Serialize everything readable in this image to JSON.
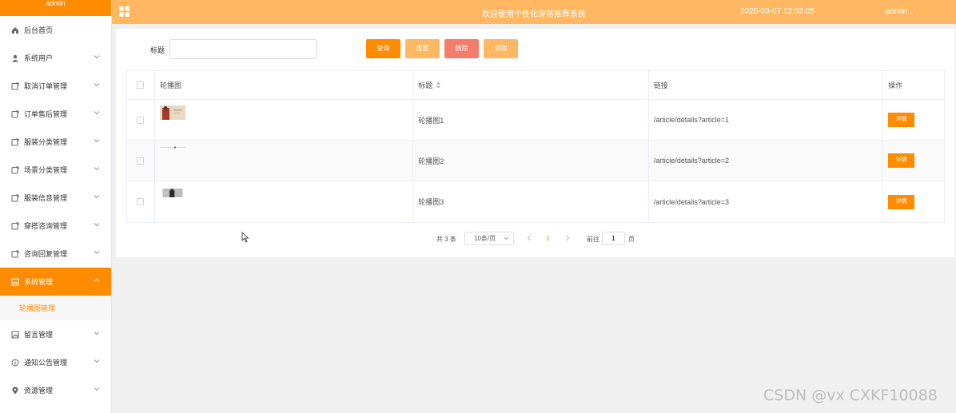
{
  "sidebar": {
    "top_label": "admin",
    "items": [
      {
        "label": "后台首页",
        "icon": "home-icon",
        "expandable": false
      },
      {
        "label": "系统用户",
        "icon": "user-icon",
        "expandable": true
      },
      {
        "label": "取消订单管理",
        "icon": "document-icon",
        "expandable": true
      },
      {
        "label": "订单售后管理",
        "icon": "document-icon",
        "expandable": true
      },
      {
        "label": "服装分类管理",
        "icon": "document-icon",
        "expandable": true
      },
      {
        "label": "场景分类管理",
        "icon": "document-icon",
        "expandable": true
      },
      {
        "label": "服装信息管理",
        "icon": "document-icon",
        "expandable": true
      },
      {
        "label": "穿搭咨询管理",
        "icon": "document-icon",
        "expandable": true
      },
      {
        "label": "咨询回复管理",
        "icon": "document-icon",
        "expandable": true
      },
      {
        "label": "系统管理",
        "icon": "picture-icon",
        "expandable": true,
        "active": true
      },
      {
        "label": "留言管理",
        "icon": "picture-icon",
        "expandable": true
      },
      {
        "label": "通知公告管理",
        "icon": "info-icon",
        "expandable": true
      },
      {
        "label": "资源管理",
        "icon": "location-icon",
        "expandable": true
      }
    ],
    "sub_item": "轮播图管理"
  },
  "header": {
    "title": "欢迎使用个性化穿搭推荐系统",
    "datetime": "2025-03-07 12:02:05",
    "user": "admin"
  },
  "search": {
    "label": "标题",
    "value": "",
    "placeholder": ""
  },
  "buttons": {
    "query": "查询",
    "reset": "重置",
    "delete": "删除",
    "add": "添加"
  },
  "table": {
    "headers": {
      "image": "轮播图",
      "title": "标题",
      "link": "链接",
      "actions": "操作"
    },
    "rows": [
      {
        "title": "轮播图1",
        "link": "/article/details?article=1",
        "action": "详情"
      },
      {
        "title": "轮播图2",
        "link": "/article/details?article=2",
        "action": "详情"
      },
      {
        "title": "轮播图3",
        "link": "/article/details?article=3",
        "action": "详情"
      }
    ]
  },
  "pagination": {
    "total": "共 3 条",
    "page_size": "10条/页",
    "current_page": "1",
    "goto_label": "前往",
    "goto_value": "1",
    "page_unit": "页"
  },
  "watermark": "CSDN @vx  CXKF10088",
  "colors": {
    "accent": "#ff8c00",
    "header": "#ffb861",
    "delete": "#f47c6b"
  }
}
